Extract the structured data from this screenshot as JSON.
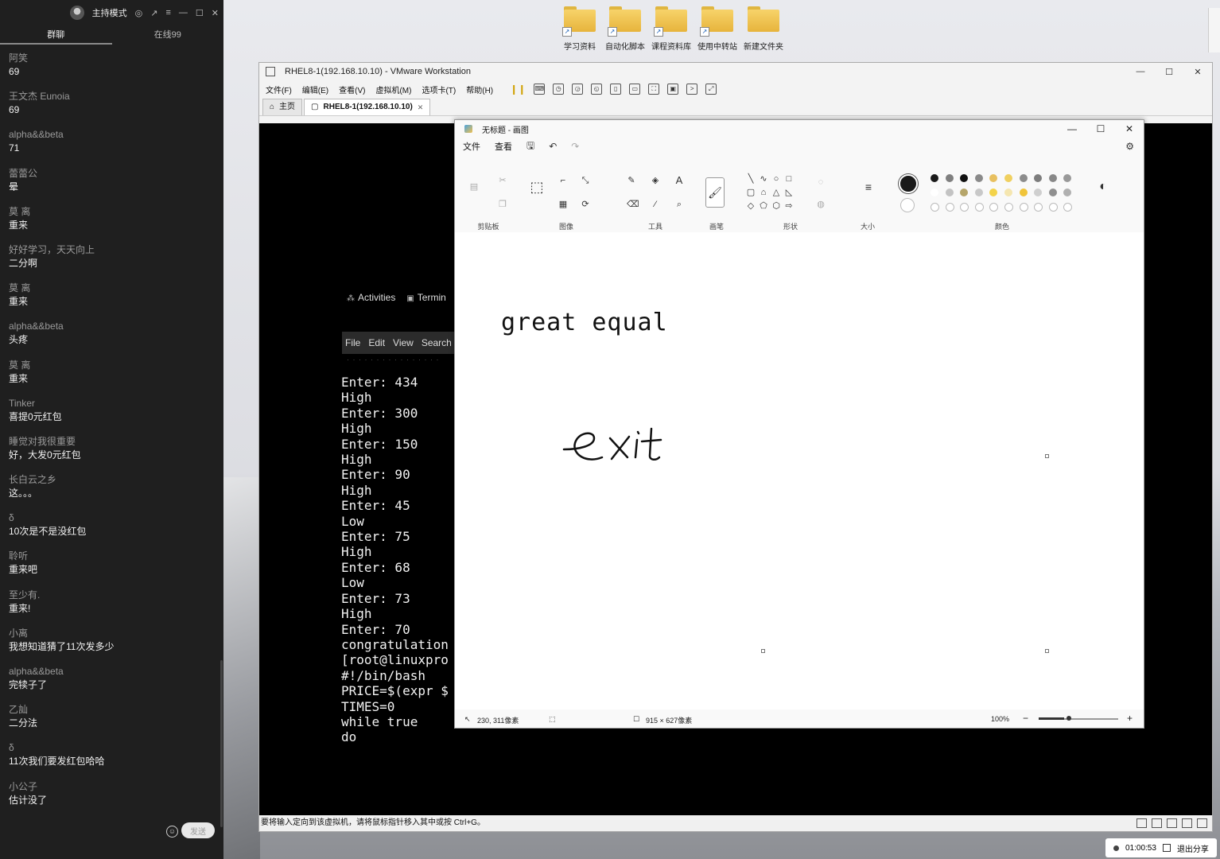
{
  "chat": {
    "title": "主持模式",
    "tabs": [
      "群聊",
      "在线99"
    ],
    "messages": [
      {
        "name": "阿笑",
        "text": "69"
      },
      {
        "name": "王文杰 Eunoia",
        "text": "69"
      },
      {
        "name": "alpha&&beta",
        "text": "71"
      },
      {
        "name": "蕾蕾公",
        "text": "晕"
      },
      {
        "name": "莫 离",
        "text": "重来"
      },
      {
        "name": "好好学习，天天向上",
        "text": "二分啊"
      },
      {
        "name": "莫 离",
        "text": "重来"
      },
      {
        "name": "alpha&&beta",
        "text": "头疼"
      },
      {
        "name": "莫 离",
        "text": "重来"
      },
      {
        "name": "Tinker",
        "text": "喜提0元红包"
      },
      {
        "name": "睡觉对我很重要",
        "text": "好，大发0元红包"
      },
      {
        "name": "长白云之乡",
        "text": "这。。。"
      },
      {
        "name": "δ",
        "text": "10次是不是没红包"
      },
      {
        "name": "聆听",
        "text": "重来吧"
      },
      {
        "name": "至少有.",
        "text": "重来!"
      },
      {
        "name": "小离",
        "text": "我想知道猜了11次发多少"
      },
      {
        "name": "alpha&&beta",
        "text": "完犊子了"
      },
      {
        "name": "乙訕",
        "text": "二分法"
      },
      {
        "name": "δ",
        "text": "11次我们要发红包哈哈"
      },
      {
        "name": "小公子",
        "text": "估计没了"
      }
    ],
    "send_label": "发送"
  },
  "desktop": {
    "icons": [
      "学习资料",
      "自动化脚本",
      "课程资料库",
      "使用中转站",
      "新建文件夹"
    ]
  },
  "vmware": {
    "title": "RHEL8-1(192.168.10.10) - VMware Workstation",
    "menu": [
      "文件(F)",
      "编辑(E)",
      "查看(V)",
      "虚拟机(M)",
      "选项卡(T)",
      "帮助(H)"
    ],
    "tabs": [
      "主页",
      "RHEL8-1(192.168.10.10)"
    ],
    "status": "要将输入定向到该虚拟机，请将鼠标指针移入其中或按 Ctrl+G。"
  },
  "guest": {
    "activities": "Activities",
    "terminal_app": "Termin",
    "terminal_menu": [
      "File",
      "Edit",
      "View",
      "Search"
    ],
    "lines": [
      "Enter: 434",
      "High",
      "Enter: 300",
      "High",
      "Enter: 150",
      "High",
      "Enter: 90",
      "High",
      "Enter: 45",
      "Low",
      "Enter: 75",
      "High",
      "Enter: 68",
      "Low",
      "Enter: 73",
      "High",
      "Enter: 70",
      "congratulation",
      "[root@linuxpro",
      "#!/bin/bash",
      "PRICE=$(expr $",
      "TIMES=0",
      "while true",
      "do"
    ]
  },
  "paint": {
    "title": "无标题 - 画图",
    "menu": [
      "文件",
      "查看"
    ],
    "groups": {
      "clipboard": "剪贴板",
      "image": "图像",
      "tools": "工具",
      "brushes": "画笔",
      "shapes": "形状",
      "size": "大小",
      "colors": "颜色"
    },
    "colors_row1": [
      "#1a1a1a",
      "#7f7f7f",
      "#111111",
      "#8a8a8a",
      "#e8c060",
      "#f0d060",
      "#8c8c8c",
      "#7d7d7d",
      "#888888",
      "#999999"
    ],
    "colors_row2": [
      "#ffffff",
      "#c3c3c3",
      "#b5a56a",
      "#c8c8c8",
      "#f3d34a",
      "#f5e6b0",
      "#f0c43a",
      "#cfcfcf",
      "#8f8f8f",
      "#b0b0b0"
    ],
    "canvas_text": "great equal",
    "handwritten": "exit",
    "status": {
      "cursor": "230, 311像素",
      "size": "915 × 627像素",
      "zoom": "100%"
    }
  },
  "share": {
    "time": "01:00:53",
    "stop_label": "退出分享"
  }
}
